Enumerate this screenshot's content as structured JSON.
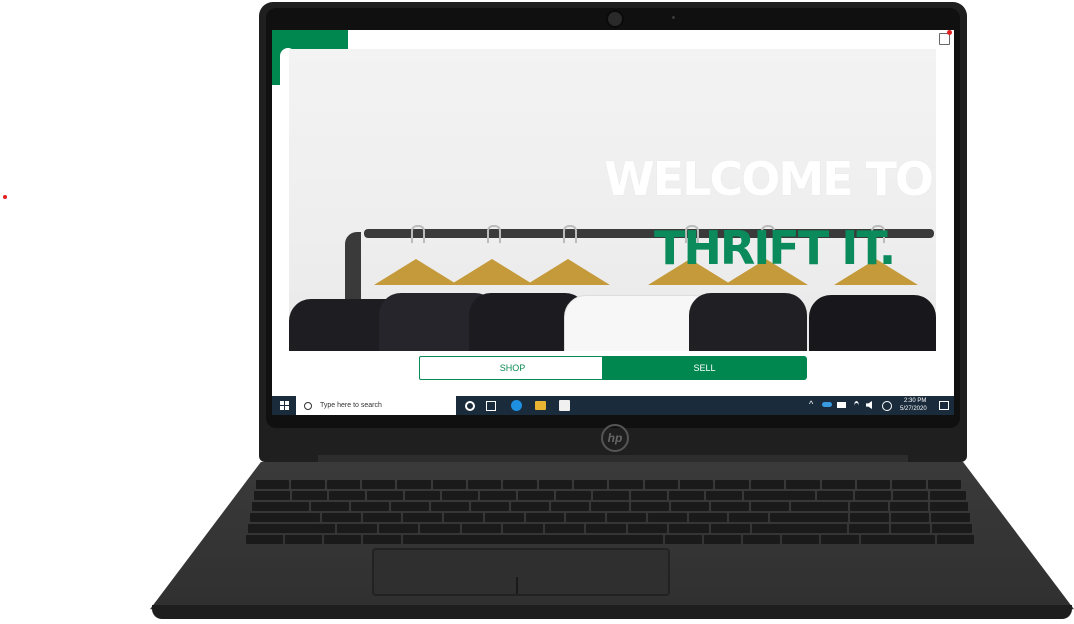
{
  "hero": {
    "headline_line1": "WELCOME TO",
    "headline_line2": "THRIFT IT."
  },
  "actions": {
    "shop_label": "SHOP",
    "sell_label": "SELL"
  },
  "taskbar": {
    "search_placeholder": "Type here to search",
    "time": "2:30 PM",
    "date": "5/27/2020"
  },
  "device": {
    "brand_logo": "hp"
  },
  "colors": {
    "brand_green": "#00874f",
    "taskbar": "#1a2b3c"
  },
  "icons": [
    "cart-icon",
    "windows-start-icon",
    "search-icon",
    "task-view-icon",
    "edge-icon",
    "file-explorer-icon",
    "store-icon",
    "wifi-icon",
    "volume-icon",
    "notification-icon"
  ]
}
